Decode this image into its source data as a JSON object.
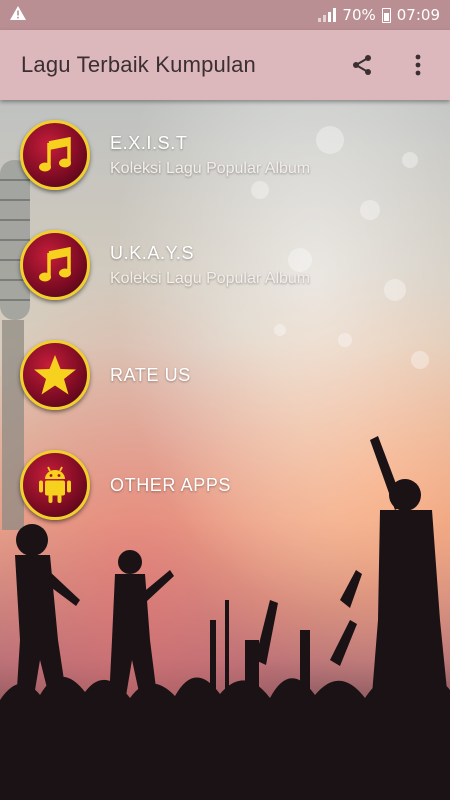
{
  "status_bar": {
    "warning_icon": "warning-icon",
    "battery_percent": "70%",
    "time": "07:09"
  },
  "app_bar": {
    "title": "Lagu Terbaik Kumpulan",
    "share_icon": "share-icon",
    "more_icon": "more-vert-icon"
  },
  "menu": {
    "items": [
      {
        "title": "E.X.I.S.T",
        "subtitle": "Koleksi Lagu Popular Album",
        "icon": "music-note-icon"
      },
      {
        "title": "U.K.A.Y.S",
        "subtitle": "Koleksi Lagu Popular Album",
        "icon": "music-note-icon"
      },
      {
        "title": "RATE US",
        "subtitle": "",
        "icon": "star-icon"
      },
      {
        "title": "OTHER APPS",
        "subtitle": "",
        "icon": "android-icon"
      }
    ]
  },
  "colors": {
    "status_bar": "#b98f93",
    "app_bar": "#dcb7bb",
    "badge_ring": "#f1cf2e",
    "badge_fill": "#9c102c",
    "icon_yellow": "#f6d11e"
  }
}
